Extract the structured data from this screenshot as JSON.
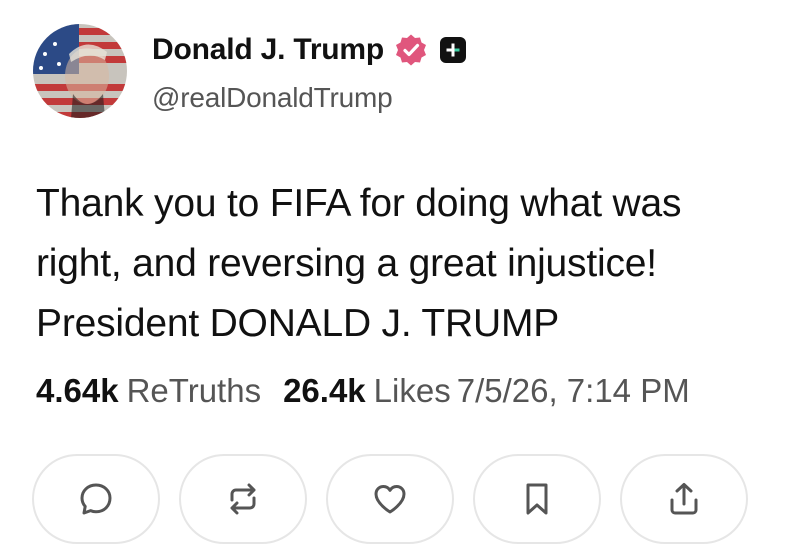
{
  "author": {
    "display_name": "Donald J. Trump",
    "handle": "@realDonaldTrump",
    "avatar_icon": "flag-portrait-avatar",
    "verified_icon": "verified-badge-icon",
    "verified_color": "#e0567d",
    "plus_icon": "plus-badge-icon"
  },
  "post": {
    "lines": [
      "Thank you to FIFA for doing what was",
      "right, and reversing a great injustice!",
      "President DONALD J. TRUMP"
    ]
  },
  "stats": {
    "retruths_count": "4.64k",
    "retruths_label": "ReTruths",
    "likes_count": "26.4k",
    "likes_label": "Likes",
    "timestamp": "7/5/26, 7:14 PM"
  },
  "actions": [
    {
      "icon": "reply-icon"
    },
    {
      "icon": "retruth-icon"
    },
    {
      "icon": "like-heart-icon"
    },
    {
      "icon": "bookmark-icon"
    },
    {
      "icon": "share-icon"
    }
  ]
}
